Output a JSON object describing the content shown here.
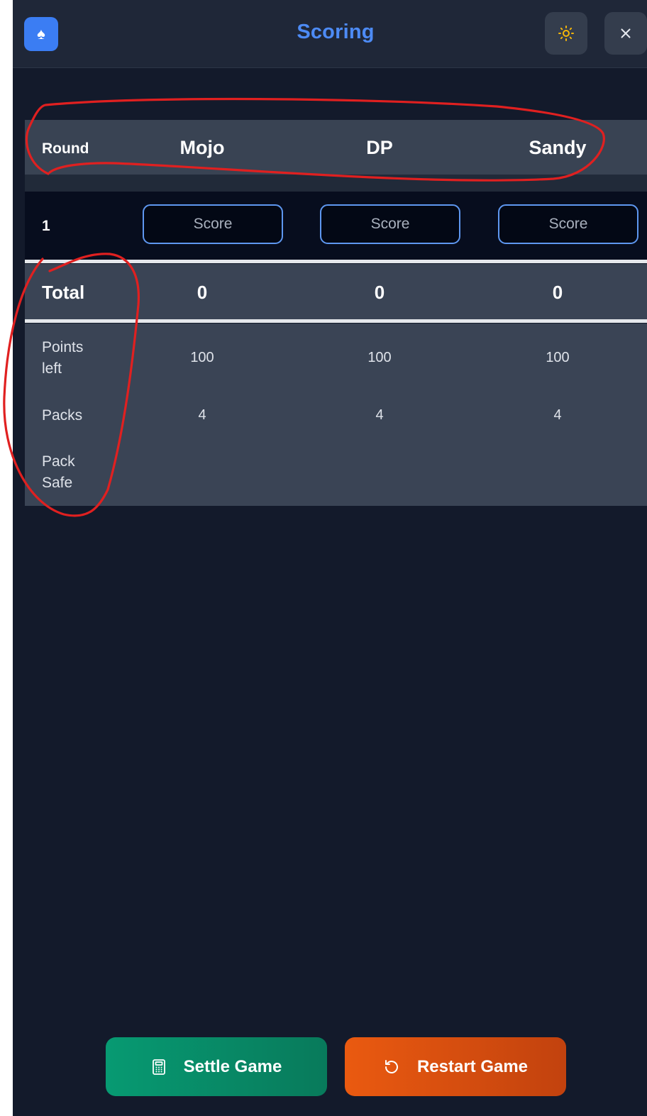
{
  "header": {
    "title": "Scoring"
  },
  "table": {
    "round_label": "Round",
    "players": [
      "Mojo",
      "DP",
      "Sandy"
    ],
    "rounds": [
      {
        "number": "1",
        "score_placeholder": "Score"
      }
    ],
    "total_label": "Total",
    "totals": [
      "0",
      "0",
      "0"
    ],
    "points_left_label": "Points left",
    "points_left": [
      "100",
      "100",
      "100"
    ],
    "packs_label": "Packs",
    "packs": [
      "4",
      "4",
      "4"
    ],
    "pack_safe_label": "Pack Safe",
    "pack_safe": [
      "",
      "",
      ""
    ]
  },
  "actions": {
    "settle_label": "Settle Game",
    "restart_label": "Restart Game"
  },
  "icons": {
    "logo": "spade-icon",
    "theme": "sun-icon",
    "close": "close-icon",
    "settle": "calculator-icon",
    "restart": "rotate-ccw-icon"
  },
  "colors": {
    "accent": "#4d8bf5",
    "settle": "#079a72",
    "restart": "#ea5a10",
    "annotation": "#e02020"
  }
}
